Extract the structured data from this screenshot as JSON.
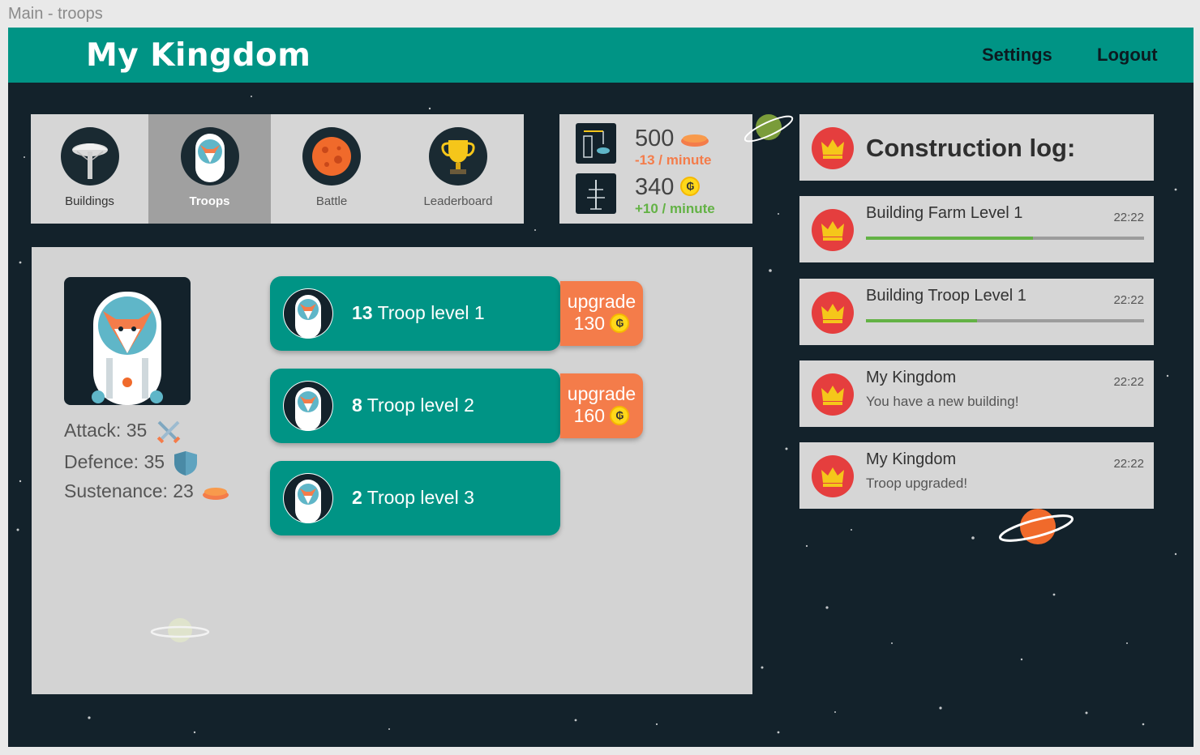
{
  "frame_label": "Main - troops",
  "header": {
    "title": "My Kingdom",
    "settings_label": "Settings",
    "logout_label": "Logout"
  },
  "tabs": [
    {
      "label": "Buildings",
      "icon": "building-tower-icon",
      "active": false
    },
    {
      "label": "Troops",
      "icon": "fox-astronaut-icon",
      "active": true
    },
    {
      "label": "Battle",
      "icon": "planet-battle-icon",
      "active": false
    },
    {
      "label": "Leaderboard",
      "icon": "trophy-icon",
      "active": false
    }
  ],
  "resources": {
    "food": {
      "value": "500",
      "rate": "-13 / minute",
      "icon": "bread-icon",
      "rate_color": "#f47c4a"
    },
    "gold": {
      "value": "340",
      "rate": "+10 / minute",
      "icon": "coin-icon",
      "rate_color": "#63b245"
    }
  },
  "stats": {
    "attack": "Attack: 35",
    "defence": "Defence: 35",
    "sustenance": "Sustenance: 23"
  },
  "troops": [
    {
      "count": "13",
      "label": "Troop level 1",
      "upgrade_label": "upgrade",
      "upgrade_cost": "130"
    },
    {
      "count": "8",
      "label": "Troop level 2",
      "upgrade_label": "upgrade",
      "upgrade_cost": "160"
    },
    {
      "count": "2",
      "label": "Troop level 3"
    }
  ],
  "construction_log": {
    "title": "Construction log:",
    "entries": [
      {
        "title": "Building Farm Level 1",
        "time": "22:22",
        "progress": 0.6
      },
      {
        "title": "Building Troop Level 1",
        "time": "22:22",
        "progress": 0.4
      },
      {
        "title": "My Kingdom",
        "time": "22:22",
        "subtitle": "You have a new building!"
      },
      {
        "title": "My Kingdom",
        "time": "22:22",
        "subtitle": "Troop upgraded!"
      }
    ]
  },
  "colors": {
    "primary": "#009485",
    "accent": "#f47c4a",
    "background": "#13222b",
    "panel": "#d6d6d6",
    "progress": "#63b245"
  }
}
